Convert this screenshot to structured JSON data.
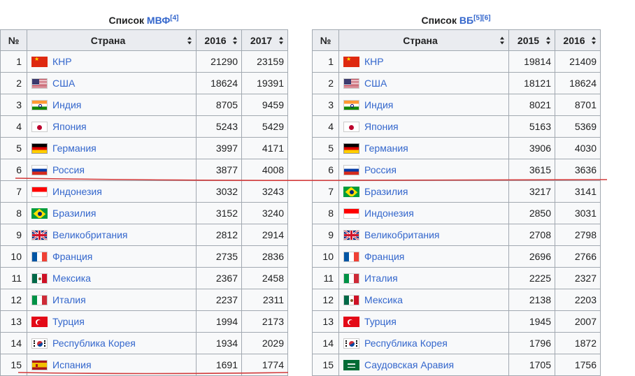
{
  "tables": [
    {
      "id": "imf",
      "caption_prefix": "Список ",
      "caption_link": "МВФ",
      "caption_refs": "[4]",
      "headers": [
        "№",
        "Страна",
        "2016",
        "2017"
      ],
      "rows": [
        {
          "rank": "1",
          "flag": "cn-flag-icon",
          "country": "КНР",
          "v1": "21290",
          "v2": "23159"
        },
        {
          "rank": "2",
          "flag": "us-flag-icon",
          "country": "США",
          "v1": "18624",
          "v2": "19391"
        },
        {
          "rank": "3",
          "flag": "in-flag-icon",
          "country": "Индия",
          "v1": "8705",
          "v2": "9459"
        },
        {
          "rank": "4",
          "flag": "jp-flag-icon",
          "country": "Япония",
          "v1": "5243",
          "v2": "5429"
        },
        {
          "rank": "5",
          "flag": "de-flag-icon",
          "country": "Германия",
          "v1": "3997",
          "v2": "4171"
        },
        {
          "rank": "6",
          "flag": "ru-flag-icon",
          "country": "Россия",
          "v1": "3877",
          "v2": "4008"
        },
        {
          "rank": "7",
          "flag": "id-flag-icon",
          "country": "Индонезия",
          "v1": "3032",
          "v2": "3243"
        },
        {
          "rank": "8",
          "flag": "br-flag-icon",
          "country": "Бразилия",
          "v1": "3152",
          "v2": "3240"
        },
        {
          "rank": "9",
          "flag": "gb-flag-icon",
          "country": "Великобритания",
          "v1": "2812",
          "v2": "2914"
        },
        {
          "rank": "10",
          "flag": "fr-flag-icon",
          "country": "Франция",
          "v1": "2735",
          "v2": "2836"
        },
        {
          "rank": "11",
          "flag": "mx-flag-icon",
          "country": "Мексика",
          "v1": "2367",
          "v2": "2458"
        },
        {
          "rank": "12",
          "flag": "it-flag-icon",
          "country": "Италия",
          "v1": "2237",
          "v2": "2311"
        },
        {
          "rank": "13",
          "flag": "tr-flag-icon",
          "country": "Турция",
          "v1": "1994",
          "v2": "2173"
        },
        {
          "rank": "14",
          "flag": "kr-flag-icon",
          "country": "Республика Корея",
          "v1": "1934",
          "v2": "2029"
        },
        {
          "rank": "15",
          "flag": "es-flag-icon",
          "country": "Испания",
          "v1": "1691",
          "v2": "1774"
        }
      ]
    },
    {
      "id": "wb",
      "caption_prefix": "Список ",
      "caption_link": "ВБ",
      "caption_refs": "[5][6]",
      "headers": [
        "№",
        "Страна",
        "2015",
        "2016"
      ],
      "rows": [
        {
          "rank": "1",
          "flag": "cn-flag-icon",
          "country": "КНР",
          "v1": "19814",
          "v2": "21409"
        },
        {
          "rank": "2",
          "flag": "us-flag-icon",
          "country": "США",
          "v1": "18121",
          "v2": "18624"
        },
        {
          "rank": "3",
          "flag": "in-flag-icon",
          "country": "Индия",
          "v1": "8021",
          "v2": "8701"
        },
        {
          "rank": "4",
          "flag": "jp-flag-icon",
          "country": "Япония",
          "v1": "5163",
          "v2": "5369"
        },
        {
          "rank": "5",
          "flag": "de-flag-icon",
          "country": "Германия",
          "v1": "3906",
          "v2": "4030"
        },
        {
          "rank": "6",
          "flag": "ru-flag-icon",
          "country": "Россия",
          "v1": "3615",
          "v2": "3636"
        },
        {
          "rank": "7",
          "flag": "br-flag-icon",
          "country": "Бразилия",
          "v1": "3217",
          "v2": "3141"
        },
        {
          "rank": "8",
          "flag": "id-flag-icon",
          "country": "Индонезия",
          "v1": "2850",
          "v2": "3031"
        },
        {
          "rank": "9",
          "flag": "gb-flag-icon",
          "country": "Великобритания",
          "v1": "2708",
          "v2": "2798"
        },
        {
          "rank": "10",
          "flag": "fr-flag-icon",
          "country": "Франция",
          "v1": "2696",
          "v2": "2766"
        },
        {
          "rank": "11",
          "flag": "it-flag-icon",
          "country": "Италия",
          "v1": "2225",
          "v2": "2327"
        },
        {
          "rank": "12",
          "flag": "mx-flag-icon",
          "country": "Мексика",
          "v1": "2138",
          "v2": "2203"
        },
        {
          "rank": "13",
          "flag": "tr-flag-icon",
          "country": "Турция",
          "v1": "1945",
          "v2": "2007"
        },
        {
          "rank": "14",
          "flag": "kr-flag-icon",
          "country": "Республика Корея",
          "v1": "1796",
          "v2": "1872"
        },
        {
          "rank": "15",
          "flag": "sa-flag-icon",
          "country": "Саудовская Аравия",
          "v1": "1705",
          "v2": "1756"
        }
      ]
    }
  ],
  "colors": {
    "link": "#3366cc",
    "header_bg": "#eaecf0",
    "cell_bg": "#f8f9fa",
    "border": "#a2a9b1",
    "annotation_line": "#d33a3a"
  }
}
